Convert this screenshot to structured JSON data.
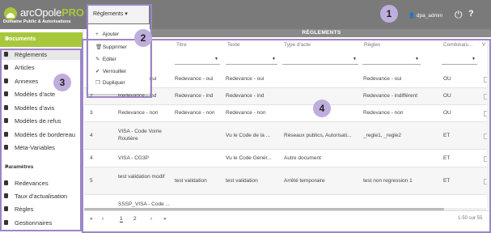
{
  "header": {
    "logo": {
      "name_plain": "arcOpole",
      "name_accent": "PRO",
      "subtitle": "Domaine Public & Autorisations"
    },
    "menu_label": "Règlements ▾",
    "user": "dpa_admin",
    "title": "RÈGLEMENTS"
  },
  "menu": {
    "items": [
      {
        "icon": "plus-icon",
        "glyph": "+",
        "label": "Ajouter"
      },
      {
        "icon": "trash-icon",
        "glyph": "🗑",
        "label": "Supprimer"
      },
      {
        "icon": "pencil-icon",
        "glyph": "✎",
        "label": "Editer"
      },
      {
        "icon": "check-icon",
        "glyph": "✔",
        "label": "Verrouiller"
      },
      {
        "icon": "copy-icon",
        "glyph": "❐",
        "label": "Dupliquer"
      }
    ]
  },
  "sidebar": {
    "section1": "Documents",
    "items": [
      "Règlements",
      "Articles",
      "Annexes",
      "Modèles d'acte",
      "Modèles d'avis",
      "Modèles de refus",
      "Modèles de bordereau",
      "Méta-Variables"
    ],
    "section2": "Paramètres",
    "items2": [
      "Redevances",
      "Taux d'actualisation",
      "Règles",
      "Gestionnaires"
    ]
  },
  "table": {
    "columns": [
      "",
      "",
      "Titre",
      "Texte",
      "Type d'acte",
      "Règles",
      "Combinais...",
      "V"
    ],
    "rows": [
      [
        "1",
        "Redevance - oui",
        "Redevance - oui",
        "Redevance - oui",
        "",
        "Redevance - oui",
        "OU"
      ],
      [
        "2",
        "Redevance - ind",
        "Redevance - ind",
        "Redevance - ind",
        "",
        "Redevance - indifférent",
        "OU"
      ],
      [
        "3",
        "Redevance - non",
        "Redevance - non",
        "Redevance - non",
        "",
        "Redevance - non",
        "OU"
      ],
      [
        "4",
        "VISA - Code Voirie Routière",
        "",
        "Vu le Code de la ...",
        "Réseaux publics, Autorisati...",
        "_regle1, _regle2",
        "ET"
      ],
      [
        "4",
        "VISA - CG3P",
        "",
        "Vu le Code Génér...",
        "Autre document",
        "",
        "ET"
      ],
      [
        "5",
        "test validation modif",
        "test validation",
        "test validation",
        "Arrêté temporaire",
        "test non regression 1",
        "ET"
      ],
      [
        "",
        "SSSP_VISA - Code ...",
        "",
        "",
        "",
        "",
        ""
      ]
    ]
  },
  "pagination": {
    "first": "«",
    "prev": "‹",
    "pages": [
      "1",
      "2"
    ],
    "next": "›",
    "last": "»",
    "count": "1-50 sur 55"
  },
  "callouts": [
    "1",
    "2",
    "3",
    "4"
  ],
  "colors": {
    "accent": "#a7c83b",
    "header": "#7a7a7a",
    "callout": "#9b86c7"
  }
}
